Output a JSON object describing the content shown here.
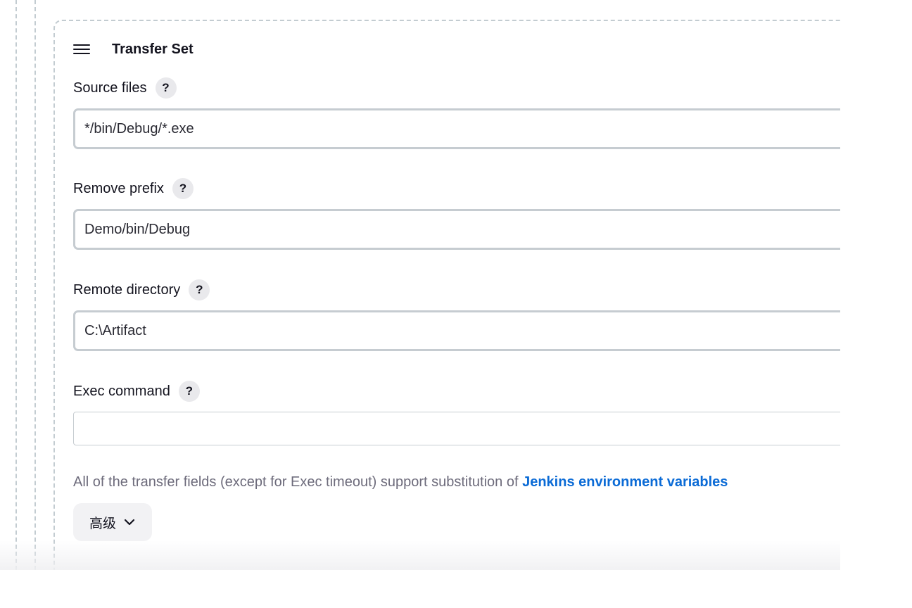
{
  "transfer_set": {
    "title": "Transfer Set",
    "help_symbol": "?",
    "fields": {
      "source_files": {
        "label": "Source files",
        "value": "*/bin/Debug/*.exe"
      },
      "remove_prefix": {
        "label": "Remove prefix",
        "value": "Demo/bin/Debug"
      },
      "remote_directory": {
        "label": "Remote directory",
        "value": "C:\\Artifact"
      },
      "exec_command": {
        "label": "Exec command",
        "value": ""
      }
    },
    "note_text": "All of the transfer fields (except for Exec timeout) support substitution of ",
    "note_link": "Jenkins environment variables",
    "advanced_label": "高级"
  },
  "icons": {
    "drag": "drag-handle-icon",
    "help": "help-icon",
    "chevron": "chevron-down-icon"
  },
  "colors": {
    "link": "#0b6bd6",
    "muted_text": "#6d6b7b",
    "input_border": "#c6ccd1",
    "dashed_border": "#c3ccd1",
    "help_bg": "#e9e9ec"
  }
}
